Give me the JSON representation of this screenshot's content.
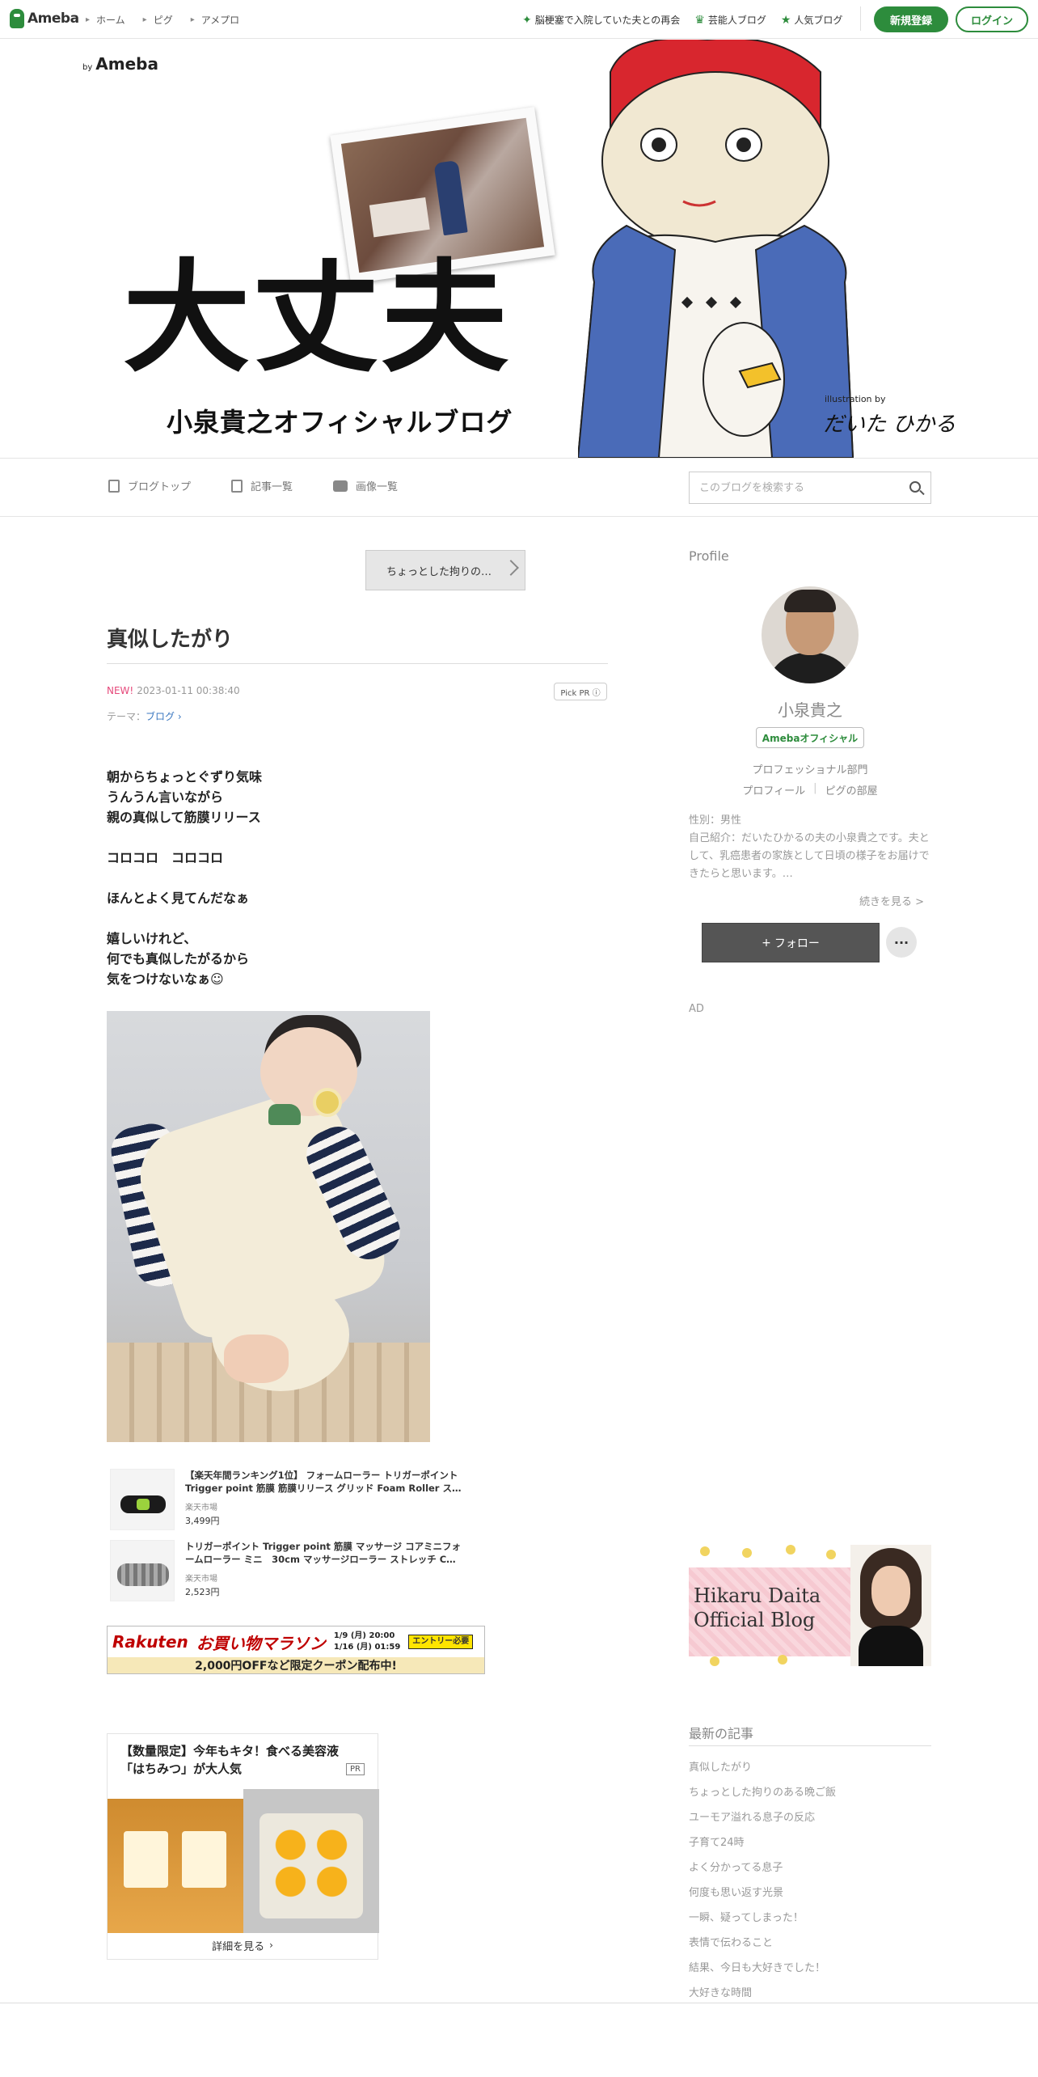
{
  "topbar": {
    "logo": "Ameba",
    "nav": [
      "ホーム",
      "ピグ",
      "アメプロ"
    ],
    "links": [
      {
        "icon": "sparkle-icon",
        "label": "脳梗塞で入院していた夫との再会"
      },
      {
        "icon": "crown-icon",
        "label": "芸能人ブログ"
      },
      {
        "icon": "star-icon",
        "label": "人気ブログ"
      }
    ],
    "register_label": "新規登録",
    "login_label": "ログイン",
    "accent": "#2d8c3c"
  },
  "banner": {
    "by": "by",
    "ameba": "Ameba",
    "title": "大丈夫",
    "subtitle": "小泉貴之オフィシャルブログ",
    "credit": "illustration by",
    "signature": "だいた ひかる"
  },
  "subnav": {
    "items": [
      {
        "icon": "document-icon",
        "label": "ブログトップ"
      },
      {
        "icon": "copy-icon",
        "label": "記事一覧"
      },
      {
        "icon": "camera-icon",
        "label": "画像一覧"
      }
    ],
    "search_placeholder": "このブログを検索する"
  },
  "article": {
    "prev_label": "ちょっとした拘りの…",
    "title": "真似したがり",
    "new_badge": "NEW!",
    "datetime": "2023-01-11 00:38:40",
    "pickpr": "Pick PR ⓘ",
    "theme_prefix": "テーマ：",
    "theme": "ブログ",
    "body": [
      [
        "朝からちょっとぐずり気味",
        "うんうん言いながら",
        "親の真似して筋膜リリース"
      ],
      [
        "コロコロ　コロコロ"
      ],
      [
        "ほんとよく見てんだなぁ"
      ],
      [
        "嬉しいけれど、",
        "何でも真似したがるから",
        "気をつけないなぁ☺︎"
      ]
    ],
    "products": [
      {
        "title": "【楽天年間ランキング1位】 フォームローラー トリガーポイント Trigger point 筋膜 筋膜リリース グリッド Foam Roller ス…",
        "shop": "楽天市場",
        "price": "3,499円"
      },
      {
        "title": "トリガーポイント Trigger point 筋膜 マッサージ コアミニフォームローラー ミニ　30cm マッサージローラー ストレッチ C…",
        "shop": "楽天市場",
        "price": "2,523円"
      }
    ],
    "rakuten_banner": {
      "logo": "Rakuten",
      "campaign": "お買い物マラソン",
      "dates": [
        "1/9 (月) 20:00",
        "1/16 (月) 01:59"
      ],
      "entry": "エントリー必要",
      "offer": "2,000円OFFなど限定クーポン配布中!"
    },
    "ad": {
      "title": "【数量限定】今年もキタ！食べる美容液「はちみつ」が大人気",
      "pr": "PR",
      "more": "詳細を見る"
    }
  },
  "sidebar": {
    "profile_heading": "Profile",
    "name": "小泉貴之",
    "badge": "Amebaオフィシャル",
    "category": "プロフェッショナル部門",
    "links": [
      "プロフィール",
      "ピグの部屋"
    ],
    "gender": "性別：男性",
    "intro": "自己紹介：だいたひかるの夫の小泉貴之です。夫として、乳癌患者の家族として日頃の様子をお届けできたらと思います。…",
    "readmore": "続きを見る >",
    "follow": "フォロー",
    "more": "···",
    "ad_label": "AD",
    "daita_banner": [
      "Hikaru Daita",
      "Official Blog"
    ],
    "latest_heading": "最新の記事",
    "latest": [
      "真似したがり",
      "ちょっとした拘りのある晩ご飯",
      "ユーモア溢れる息子の反応",
      "子育て24時",
      "よく分かってる息子",
      "何度も思い返す光景",
      "一瞬、疑ってしまった！",
      "表情で伝わること",
      "結果、今日も大好きでした！",
      "大好きな時間"
    ]
  }
}
